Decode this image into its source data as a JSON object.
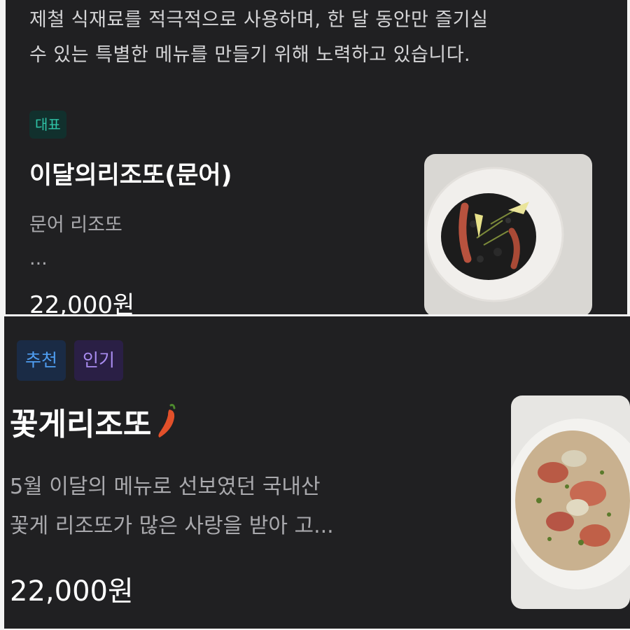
{
  "intro": {
    "line1": "제철 식재료를 적극적으로 사용하며, 한 달 동안만 즐기실",
    "line2": "수 있는 특별한 메뉴를 만들기 위해 노력하고 있습니다."
  },
  "items": [
    {
      "badges": [
        "대표"
      ],
      "title": "이달의리조또(문어)",
      "description_line1": "문어 리조또",
      "description_line2": "...",
      "price": "22,000원",
      "image_icon": "risotto-octopus-photo"
    },
    {
      "badges": [
        "추천",
        "인기"
      ],
      "title": "꽃게리조또",
      "title_icon": "chili-pepper-icon",
      "description_line1": "5월 이달의 메뉴로 선보였던 국내산",
      "description_line2": "꽃게 리조또가 많은 사랑을 받아 고...",
      "price": "22,000원",
      "image_icon": "risotto-crab-photo"
    }
  ],
  "colors": {
    "background": "#202022",
    "badge_rep": "#2fc3a7",
    "badge_rec": "#4f9df0",
    "badge_pop": "#a98cf0"
  }
}
